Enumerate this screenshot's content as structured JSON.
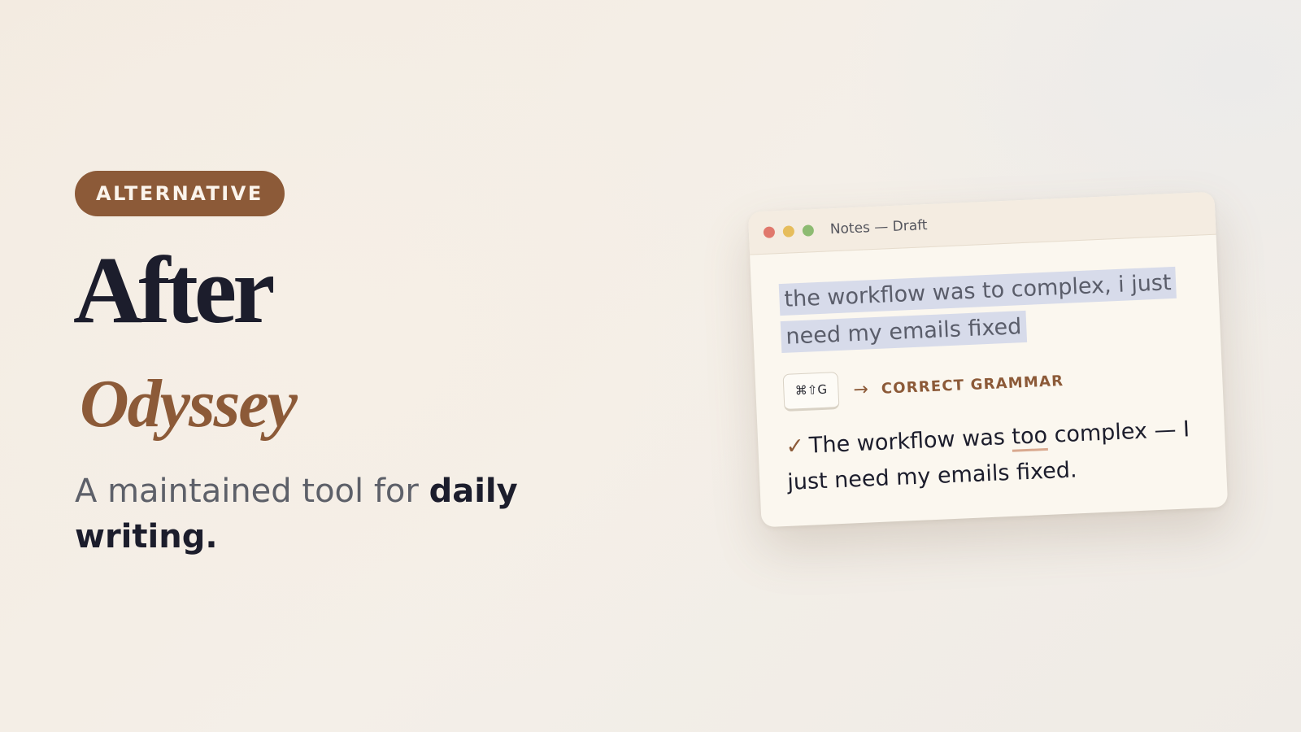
{
  "badge": "ALTERNATIVE",
  "title": "After",
  "subtitle": "Odyssey",
  "tagline": {
    "plain": "A maintained tool for ",
    "bold": "daily writing."
  },
  "window": {
    "title": "Notes — Draft",
    "traffic_lights": [
      "close",
      "minimize",
      "zoom"
    ],
    "original_text_line1": "the workflow was to complex, i just",
    "original_text_line2": "need my emails fixed",
    "shortcut": "⌘⇧G",
    "arrow": "→",
    "action_label": "CORRECT GRAMMAR",
    "check_icon": "✓",
    "result": {
      "before_fix": "The workflow was ",
      "fix": "too",
      "after_fix": " complex — I just need my emails fixed."
    }
  },
  "colors": {
    "accent": "#8c5a38",
    "ink": "#1c1d2c",
    "muted": "#5d6069",
    "highlight": "#d7dbea",
    "window_bg": "#fbf7ef",
    "titlebar_bg": "#f4ece1"
  }
}
